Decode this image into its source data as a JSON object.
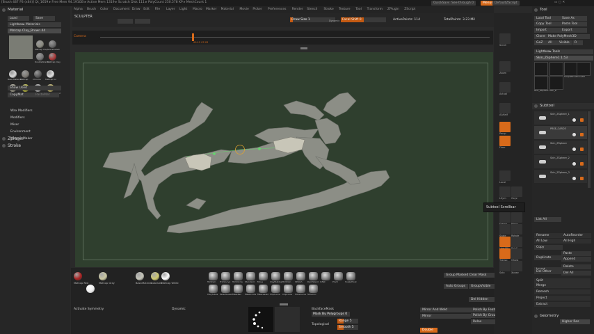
{
  "titlebar": {
    "info": "[Brush 487 P3 (x64)]   Qt_1659   ▸ Free Mem 94.191GB  ▸ Active Mem 1319  ▸ Scratch Disk 111  ▸ PolyCount 250.578 KP  ▸ MeshCount 1",
    "quicksave": "QuickSave",
    "seethrough": "See-through  0",
    "menus": "Menus",
    "script": "DefaultZScript"
  },
  "menubar": [
    "Alpha",
    "Brush",
    "Color",
    "Document",
    "Draw",
    "Edit",
    "File",
    "Layer",
    "Light",
    "Macro",
    "Marker",
    "Material",
    "Movie",
    "Picker",
    "Preferences",
    "Render",
    "Stencil",
    "Stroke",
    "Texture",
    "Tool",
    "Transform",
    "ZPlugin",
    "ZScript"
  ],
  "toprow": {
    "label": "SCULPTER",
    "draw_size": "Draw Size 1",
    "dynamic": "Dynamic",
    "focal_shift": "Focal Shift 0",
    "active_points": "ActivePoints: 114",
    "total_points": "TotalPoints: 3.23 Mil",
    "lightbox": "LightBox"
  },
  "timeline": {
    "label": "Camera",
    "time": "00:12  07:03"
  },
  "left": {
    "header": "Material",
    "load": "Load",
    "save": "Save",
    "lightbox_materials": "Lightbox▸ Materials",
    "current_material": "Matcap Clay_Brown 44",
    "thumbs": [
      "Matcap Clay",
      "SkinShade4",
      "DoubleShade",
      "MatCap Clay",
      "BasicMaterial",
      "MatCap",
      "Chrome",
      "MatCap Gr",
      "MatCap Red",
      "MatCap White",
      "Colorized",
      "BasicMaterial2",
      "Flat Color",
      "Chrome B"
    ],
    "show_used": "Show Used",
    "copy_mat": "CopyMat",
    "paste_mat": "PasteMat",
    "sections": [
      "Wax Modifiers",
      "Modifiers",
      "Mixer",
      "Environment",
      "Matcap Maker"
    ],
    "zplugin": "Zplugin",
    "stroke": "Stroke"
  },
  "right": {
    "header": "Tool",
    "buttons": [
      "Load Tool",
      "Save As",
      "Copy Tool",
      "Paste Tool",
      "Import",
      "Export",
      "Clone",
      "Make PolyMesh3D",
      "GoZ",
      "All",
      "Visible",
      "R"
    ],
    "lightbox_tools": "Lightbox▸ Tools",
    "current_tool": "Skin_ZSphere1  1.53",
    "tool_thumbs": [
      "Skin_ZSphere",
      "PolyMesh",
      "SimpleBrush",
      "Cone3D",
      "Skin_ZSphere",
      "Skin_Z"
    ],
    "subtool_header": "Subtool",
    "subtools": [
      "Skin_ZSphere_1",
      "PBSE_CARD3",
      "Skin_ZSphere",
      "Skin_ZSphere_2",
      "Skin_ZSphere_3"
    ],
    "list_all": "List All",
    "actions": [
      "Rename",
      "AutoReorder",
      "All Low",
      "All High",
      "Copy",
      "Paste",
      "Duplicate",
      "Append",
      "Insert",
      "Delete",
      "Del Other",
      "Del All",
      "Split",
      "Merge",
      "Remesh",
      "Project",
      "Extract"
    ],
    "geometry": "Geometry",
    "higher_res": "Higher Res"
  },
  "shelf": [
    "Scroll",
    "Zoom",
    "Actual",
    "AAHalf",
    "Persp",
    "Floor",
    "Local",
    "LSym",
    "Gxyz",
    "Frame",
    "Move",
    "Scale",
    "Rotate",
    "Line Fill",
    "PolyF",
    "Transp",
    "Ghost",
    "Solo",
    "Xpose"
  ],
  "tooltip": "Subtool Scrollbar",
  "bottom": {
    "materials": [
      "MatCap Red",
      "MatCap Gray",
      "BasicMaterial",
      "Colorized",
      "MatCap White"
    ],
    "brushes": [
      "TrimDyn",
      "TrimCurve",
      "TrimCircle",
      "Standard",
      "Move",
      "ClayBuildup",
      "TrimDyn",
      "hPolish",
      "DamStand",
      "Inflat",
      "Pinch",
      "SnakeHook",
      "ClayTubes",
      "SelectLasso",
      "MaskPen",
      "MaskCircle",
      "MaskLasso",
      "ClipCurve",
      "ClipCircle",
      "SliceCurve",
      "SliceCirc"
    ],
    "activate_symmetry": "Activate Symmetry",
    "dynamic": "Dynamic",
    "backface": "BackfaceMask",
    "mask_by_polygroups": "Mask By Polygroups 0",
    "range": "Range 5",
    "smooth": "Smooth 5",
    "topological": "Topological",
    "mirror_weld": "Mirror And Weld",
    "mirror": "Mirror",
    "double": "Double",
    "group_masked": "Group Masked Clear Mask",
    "auto_groups": "Auto Groups",
    "group_visible": "GroupVisible",
    "polish_features": "Polish By Features",
    "polish_groups": "Polish By Groups",
    "relax": "Relax",
    "del_hidden": "Del Hidden"
  },
  "colors": {
    "accent": "#d86a1a",
    "canvas": "#2f3f2e",
    "mesh": "#8f9188"
  }
}
